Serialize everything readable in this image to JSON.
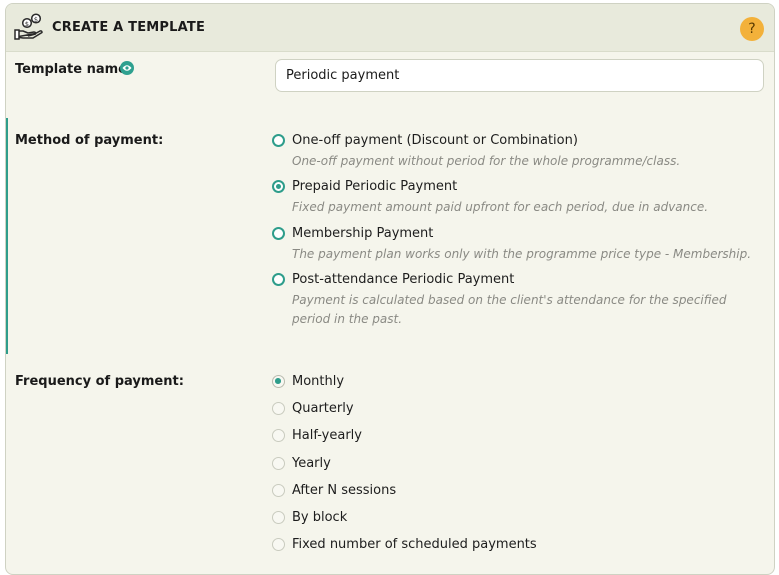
{
  "header": {
    "title": "CREATE A TEMPLATE",
    "help_label": "?",
    "icon": "money-hand-icon"
  },
  "template_name": {
    "label": "Template name",
    "value": "Periodic payment",
    "info_icon": "eye-icon"
  },
  "method": {
    "label": "Method of payment:",
    "options": [
      {
        "title": "One-off payment (Discount or Combination)",
        "description": "One-off payment without period for the whole programme/class.",
        "selected": false
      },
      {
        "title": "Prepaid Periodic Payment",
        "description": "Fixed payment amount paid upfront for each period, due in advance.",
        "selected": true
      },
      {
        "title": "Membership Payment",
        "description": "The payment plan works only with the programme price type - Membership.",
        "selected": false
      },
      {
        "title": "Post-attendance Periodic Payment",
        "description": "Payment is calculated based on the client's attendance for the specified period in the past.",
        "selected": false
      }
    ]
  },
  "frequency": {
    "label": "Frequency of payment:",
    "options": [
      {
        "title": "Monthly",
        "selected": true
      },
      {
        "title": "Quarterly",
        "selected": false
      },
      {
        "title": "Half-yearly",
        "selected": false
      },
      {
        "title": "Yearly",
        "selected": false
      },
      {
        "title": "After N sessions",
        "selected": false
      },
      {
        "title": "By block",
        "selected": false
      },
      {
        "title": "Fixed number of scheduled payments",
        "selected": false
      }
    ]
  },
  "colors": {
    "accent": "#2e9d8b",
    "help_badge": "#f3b13a",
    "header_bg": "#e8eadc",
    "panel_bg": "#f5f5ec"
  }
}
